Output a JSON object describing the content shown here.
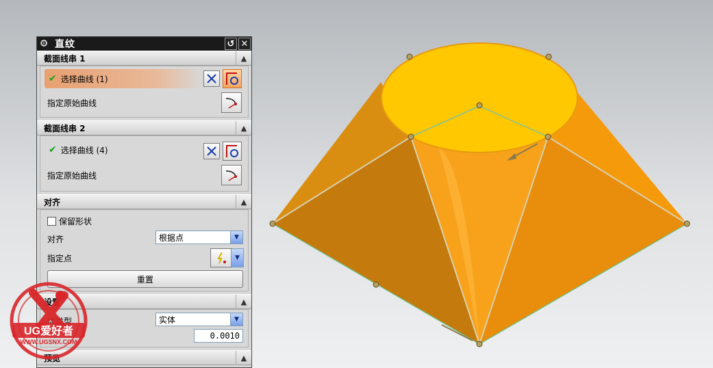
{
  "dialog": {
    "title": "直纹",
    "section1": {
      "header": "截面线串 1",
      "select_curve": "选择曲线 (1)",
      "specify_origin": "指定原始曲线"
    },
    "section2": {
      "header": "截面线串 2",
      "select_curve": "选择曲线 (4)",
      "specify_origin": "指定原始曲线"
    },
    "alignment": {
      "header": "对齐",
      "keep_shape": "保留形状",
      "align_label": "对齐",
      "align_value": "根据点",
      "specify_point": "指定点",
      "reset": "重置"
    },
    "settings": {
      "header": "设置",
      "body_type_label": "体类型",
      "body_type_value": "实体",
      "tolerance_value": "0.0010"
    },
    "preview": {
      "header": "预览"
    }
  },
  "watermark": {
    "brand": "UG爱好者",
    "url": "WWW.UGSNX.COM"
  },
  "colors": {
    "model_orange": "#f5a11c",
    "top_face": "#ffc800",
    "accent_selection": "#e8a070",
    "logo_red": "#d8262a"
  },
  "icons": {
    "title_settings": "gear-icon",
    "title_reset": "reset-icon",
    "title_close": "close-icon",
    "reverse_direction": "reverse-direction-icon",
    "curve_rule": "curve-rule-icon",
    "origin_curve": "origin-curve-icon",
    "point_dialog": "point-dialog-icon"
  }
}
